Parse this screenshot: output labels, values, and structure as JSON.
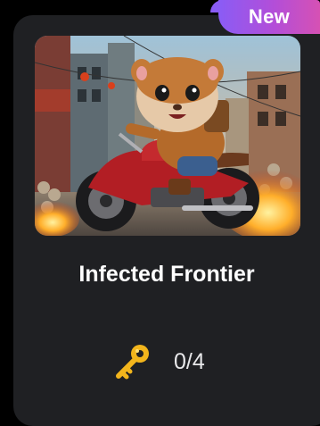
{
  "card": {
    "badge_label": "New",
    "title": "Infected Frontier",
    "keys": {
      "icon": "key-icon",
      "progress_text": "0/4",
      "collected": 0,
      "total": 4
    }
  },
  "colors": {
    "card_bg": "#1f2023",
    "badge_gradient": [
      "#8a5cf5",
      "#d651b4"
    ],
    "key_gold": "#f2b51c"
  }
}
